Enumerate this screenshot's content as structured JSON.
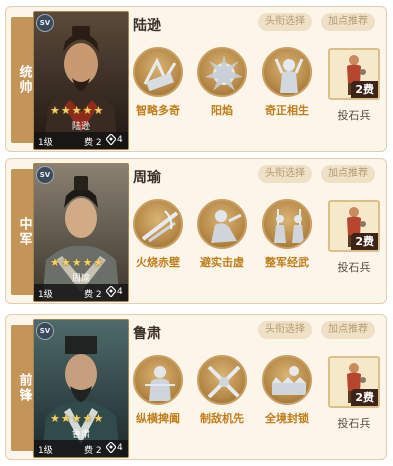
{
  "cards": [
    {
      "position": "统帅",
      "hero_name": "陆逊",
      "portrait_name": "陆逊",
      "stars": "★★★★★",
      "level": "1级",
      "cost": "费 2",
      "range": "4",
      "title_select": "头衔选择",
      "bonus_rec": "加点推荐",
      "skills": [
        "智略多奇",
        "阳焰",
        "奇正相生"
      ],
      "soldier_cost": "2费",
      "soldier_label": "投石兵"
    },
    {
      "position": "中军",
      "hero_name": "周瑜",
      "portrait_name": "周瑜",
      "stars": "★★★★★",
      "level": "1级",
      "cost": "费 2",
      "range": "4",
      "title_select": "头衔选择",
      "bonus_rec": "加点推荐",
      "skills": [
        "火烧赤壁",
        "避实击虚",
        "整军经武"
      ],
      "soldier_cost": "2费",
      "soldier_label": "投石兵"
    },
    {
      "position": "前锋",
      "hero_name": "鲁肃",
      "portrait_name": "鲁肃",
      "stars": "★★★★★",
      "level": "1级",
      "cost": "费 2",
      "range": "4",
      "title_select": "头衔选择",
      "bonus_rec": "加点推荐",
      "skills": [
        "纵横捭阖",
        "制敌机先",
        "全境封锁"
      ],
      "soldier_cost": "2费",
      "soldier_label": "投石兵"
    }
  ],
  "badge": "SV",
  "colors": {
    "card_bg": "#fbf5ea",
    "accent_gold": "#c49558",
    "skill_label": "#c07d1a"
  }
}
